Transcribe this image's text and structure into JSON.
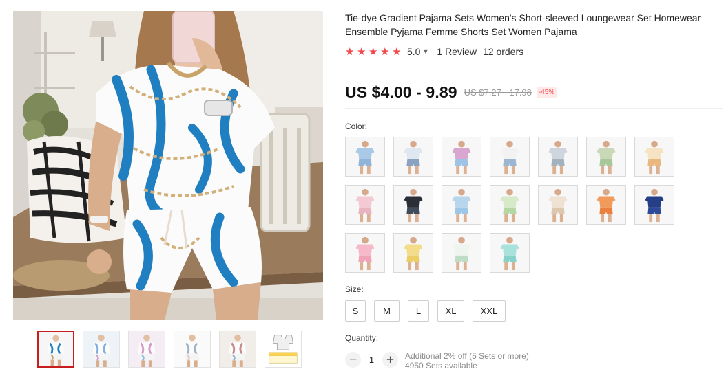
{
  "product": {
    "title": "Tie-dye Gradient Pajama Sets Women's Short-sleeved Loungewear Set Homewear Ensemble Pyjama Femme Shorts Set Women Pajama",
    "rating": 5.0,
    "rating_text": "5.0",
    "reviews_text": "1 Review",
    "orders_text": "12 orders",
    "price": "US $4.00 - 9.89",
    "original_price": "US $7.27 - 17.98",
    "discount": "-45%"
  },
  "gallery": {
    "main_image": "woman-mirror-selfie-chain-print-pajama",
    "thumbnails": [
      {
        "depicts": "pajama-white-blue-chain",
        "active": true
      },
      {
        "depicts": "pajama-tie-dye-blue"
      },
      {
        "depicts": "pajama-tie-dye-pink"
      },
      {
        "depicts": "pajama-detail-collage"
      },
      {
        "depicts": "pajama-model-pose"
      },
      {
        "depicts": "size-chart"
      }
    ]
  },
  "color": {
    "label": "Color:",
    "options": [
      {
        "name": "blue-tie-dye",
        "top": "#a9c9e6",
        "bottom": "#8fb3d9"
      },
      {
        "name": "navy-white",
        "top": "#dfe7f0",
        "bottom": "#8aa2c2"
      },
      {
        "name": "pink-blue-tie-dye",
        "top": "#d8a7d0",
        "bottom": "#9fc3e5"
      },
      {
        "name": "white-chain",
        "top": "#f2f2f2",
        "bottom": "#9ab6d0"
      },
      {
        "name": "grey-print",
        "top": "#cfd5dc",
        "bottom": "#a4b2c0"
      },
      {
        "name": "green-print",
        "top": "#c9d9b8",
        "bottom": "#a8c79a"
      },
      {
        "name": "orange-floral",
        "top": "#f5e3c4",
        "bottom": "#e8b87e"
      },
      {
        "name": "pink-print",
        "top": "#f3cad3",
        "bottom": "#e9b3c0"
      },
      {
        "name": "black-dots",
        "top": "#2b2f38",
        "bottom": "#3f4a5a"
      },
      {
        "name": "light-blue",
        "top": "#b7d6ee",
        "bottom": "#9ec6e6"
      },
      {
        "name": "green-leaf",
        "top": "#d6e9c9",
        "bottom": "#b6d7a3"
      },
      {
        "name": "beige-print",
        "top": "#efe2d2",
        "bottom": "#ddc7ae"
      },
      {
        "name": "orange",
        "top": "#f09a5b",
        "bottom": "#ea7f3e"
      },
      {
        "name": "navy-stars",
        "top": "#253f87",
        "bottom": "#2c4a98"
      },
      {
        "name": "pink-floral",
        "top": "#f6b9c9",
        "bottom": "#f0a2b6"
      },
      {
        "name": "yellow",
        "top": "#f3dc8a",
        "bottom": "#eccd66"
      },
      {
        "name": "white-green",
        "top": "#eef4ee",
        "bottom": "#bfdcc4"
      },
      {
        "name": "mint",
        "top": "#a9e1dc",
        "bottom": "#86d2cb"
      }
    ]
  },
  "size": {
    "label": "Size:",
    "options": [
      "S",
      "M",
      "L",
      "XL",
      "XXL"
    ]
  },
  "quantity": {
    "label": "Quantity:",
    "value": "1",
    "minus": "−",
    "plus": "+",
    "bulk_offer": "Additional 2% off (5 Sets or more)",
    "available": "4950 Sets available"
  },
  "colors": {
    "star": "#f2484b",
    "discount_text": "#f2484b",
    "discount_bg": "#ffe8e8",
    "active_thumb_border": "#c81e1e"
  }
}
